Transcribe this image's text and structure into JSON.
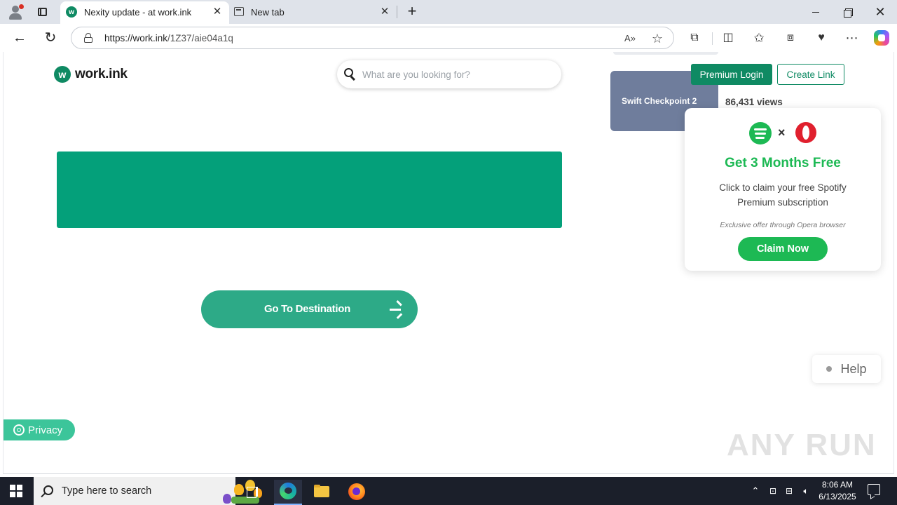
{
  "browser": {
    "tabs": [
      {
        "label": "Nexity update - at work.ink",
        "favicon": "work-ink-icon",
        "active": true
      },
      {
        "label": "New tab",
        "favicon": "new-tab-icon",
        "active": false
      }
    ],
    "url_host": "https://work.ink",
    "url_path": "/1Z37/aie04a1q",
    "read_aloud_icon": "A»"
  },
  "site": {
    "logo_mark": "w",
    "logo_text": "work.ink",
    "search_placeholder": "What are you looking for?",
    "premium_login": "Premium Login",
    "create_link": "Create Link",
    "thumbnail_title": "Swift Checkpoint 2",
    "views": "86,431 views",
    "go_button": "Go To Destination",
    "privacy": "Privacy",
    "help": "Help",
    "accent": "#0f8a63",
    "banner_color": "#04a07a"
  },
  "ad": {
    "times": "×",
    "title": "Get 3 Months Free",
    "text": "Click to claim your free Spotify Premium subscription",
    "fine_print": "Exclusive offer through Opera browser",
    "cta": "Claim Now",
    "color": "#1db954"
  },
  "watermark": "ANY RUN",
  "taskbar": {
    "search_text": "Type here to search",
    "time": "8:06 AM",
    "date": "6/13/2025"
  }
}
